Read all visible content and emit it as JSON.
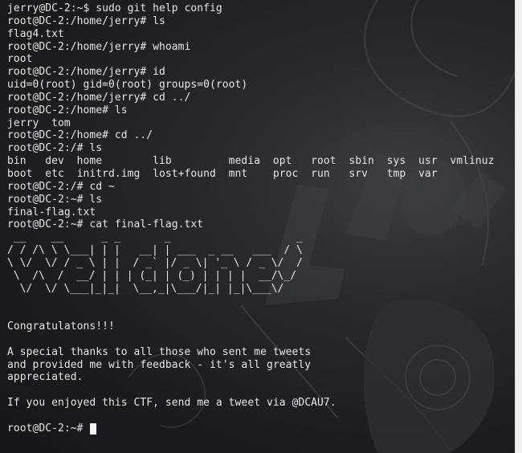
{
  "terminal": {
    "lines": [
      "jerry@DC-2:~$ sudo git help config",
      "root@DC-2:/home/jerry# ls",
      "flag4.txt",
      "root@DC-2:/home/jerry# whoami",
      "root",
      "root@DC-2:/home/jerry# id",
      "uid=0(root) gid=0(root) groups=0(root)",
      "root@DC-2:/home/jerry# cd ../",
      "root@DC-2:/home# ls",
      "jerry  tom",
      "root@DC-2:/home# cd ../",
      "root@DC-2:/# ls",
      "bin   dev  home        lib         media  opt   root  sbin  sys  usr  vmlinuz",
      "boot  etc  initrd.img  lost+found  mnt    proc  run   srv   tmp  var",
      "root@DC-2:/# cd ~",
      "root@DC-2:~# ls",
      "final-flag.txt",
      "root@DC-2:~# cat final-flag.txt"
    ],
    "ascii_art": [
      " __    __      _ _       _                    _ ",
      "/ / /\\ \\ \\___| | |   __| | ___  _ __   ___  / \\",
      "\\ \\/  \\/ / _ \\ | |  / _` |/ _ \\| '_ \\ / _ \\/  /",
      " \\  /\\  /  __/ | | | (_| | (_) | | | |  __/\\_/ ",
      "  \\/  \\/ \\___|_|_|  \\__,_|\\___/|_| |_|\\___\\/   "
    ],
    "message": [
      "",
      "",
      "Congratulatons!!!",
      "",
      "A special thanks to all those who sent me tweets",
      "and provided me with feedback - it's all greatly",
      "appreciated.",
      "",
      "If you enjoyed this CTF, send me a tweet via @DCAU7.",
      ""
    ],
    "final_prompt": "root@DC-2:~# "
  },
  "colors": {
    "text": "#e6e6e6",
    "background": "#1b1c20",
    "cursor": "#f2f2f2"
  }
}
